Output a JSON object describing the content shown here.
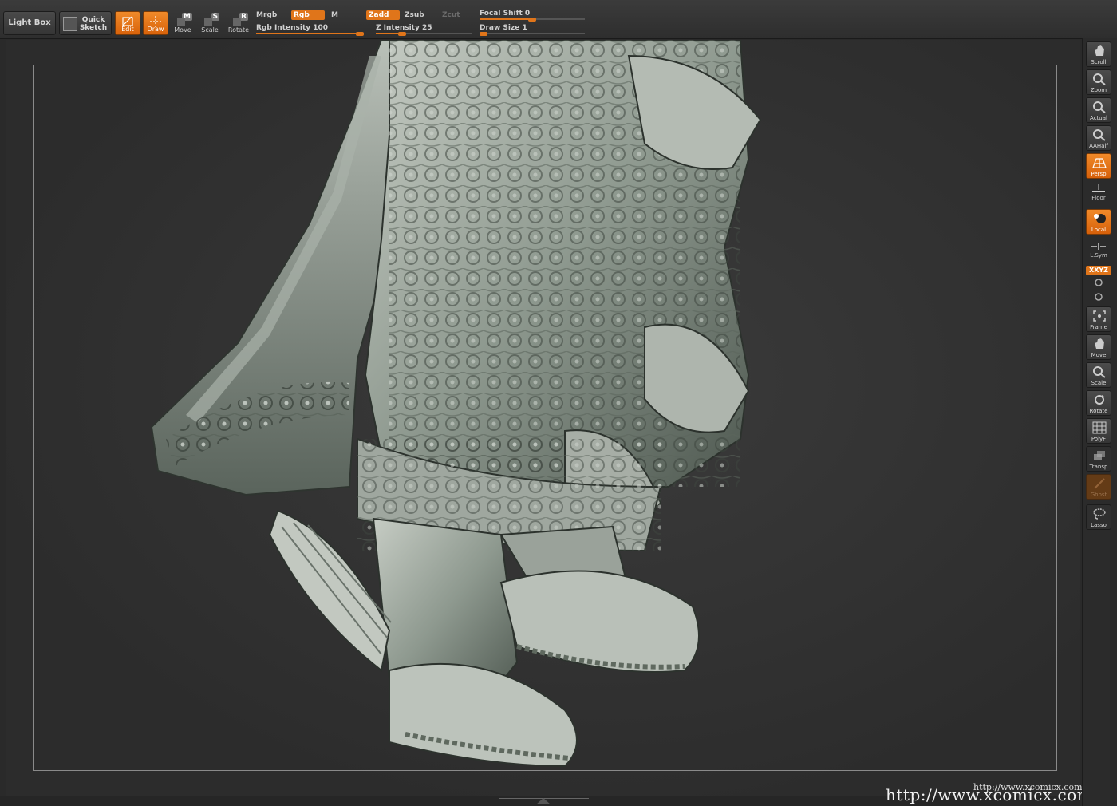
{
  "toolbar": {
    "lightbox": "Light Box",
    "quicksketch_1": "Quick",
    "quicksketch_2": "Sketch",
    "edit": "Edit",
    "draw": "Draw",
    "move": "Move",
    "move_key": "M",
    "scale": "Scale",
    "scale_key": "S",
    "rotate": "Rotate",
    "rotate_key": "R",
    "mrgb": "Mrgb",
    "rgb": "Rgb",
    "m": "M",
    "zadd": "Zadd",
    "zsub": "Zsub",
    "zcut": "Zcut",
    "rgb_intensity": "Rgb Intensity 100",
    "z_intensity": "Z Intensity 25",
    "focal_shift": "Focal Shift 0",
    "draw_size": "Draw Size 1"
  },
  "sliders": {
    "rgb_intensity": 100,
    "z_intensity": 25,
    "focal_shift": 0,
    "draw_size": 1
  },
  "rightshelf": {
    "scroll": "Scroll",
    "zoom": "Zoom",
    "actual": "Actual",
    "aahalf": "AAHalf",
    "persp": "Persp",
    "floor": "Floor",
    "local": "Local",
    "lsym": "L.Sym",
    "xyz": "XXYZ",
    "frame": "Frame",
    "move": "Move",
    "scale": "Scale",
    "rotate": "Rotate",
    "polyf": "PolyF",
    "transp": "Transp",
    "ghost": "Ghost",
    "lasso": "Lasso"
  },
  "watermark": {
    "small": "http://www.xcomicx.com",
    "large": "http://www.xcomicx.com"
  },
  "colors": {
    "accent": "#e0751a",
    "background": "#2a2a2a",
    "model": "#9aa59c"
  }
}
